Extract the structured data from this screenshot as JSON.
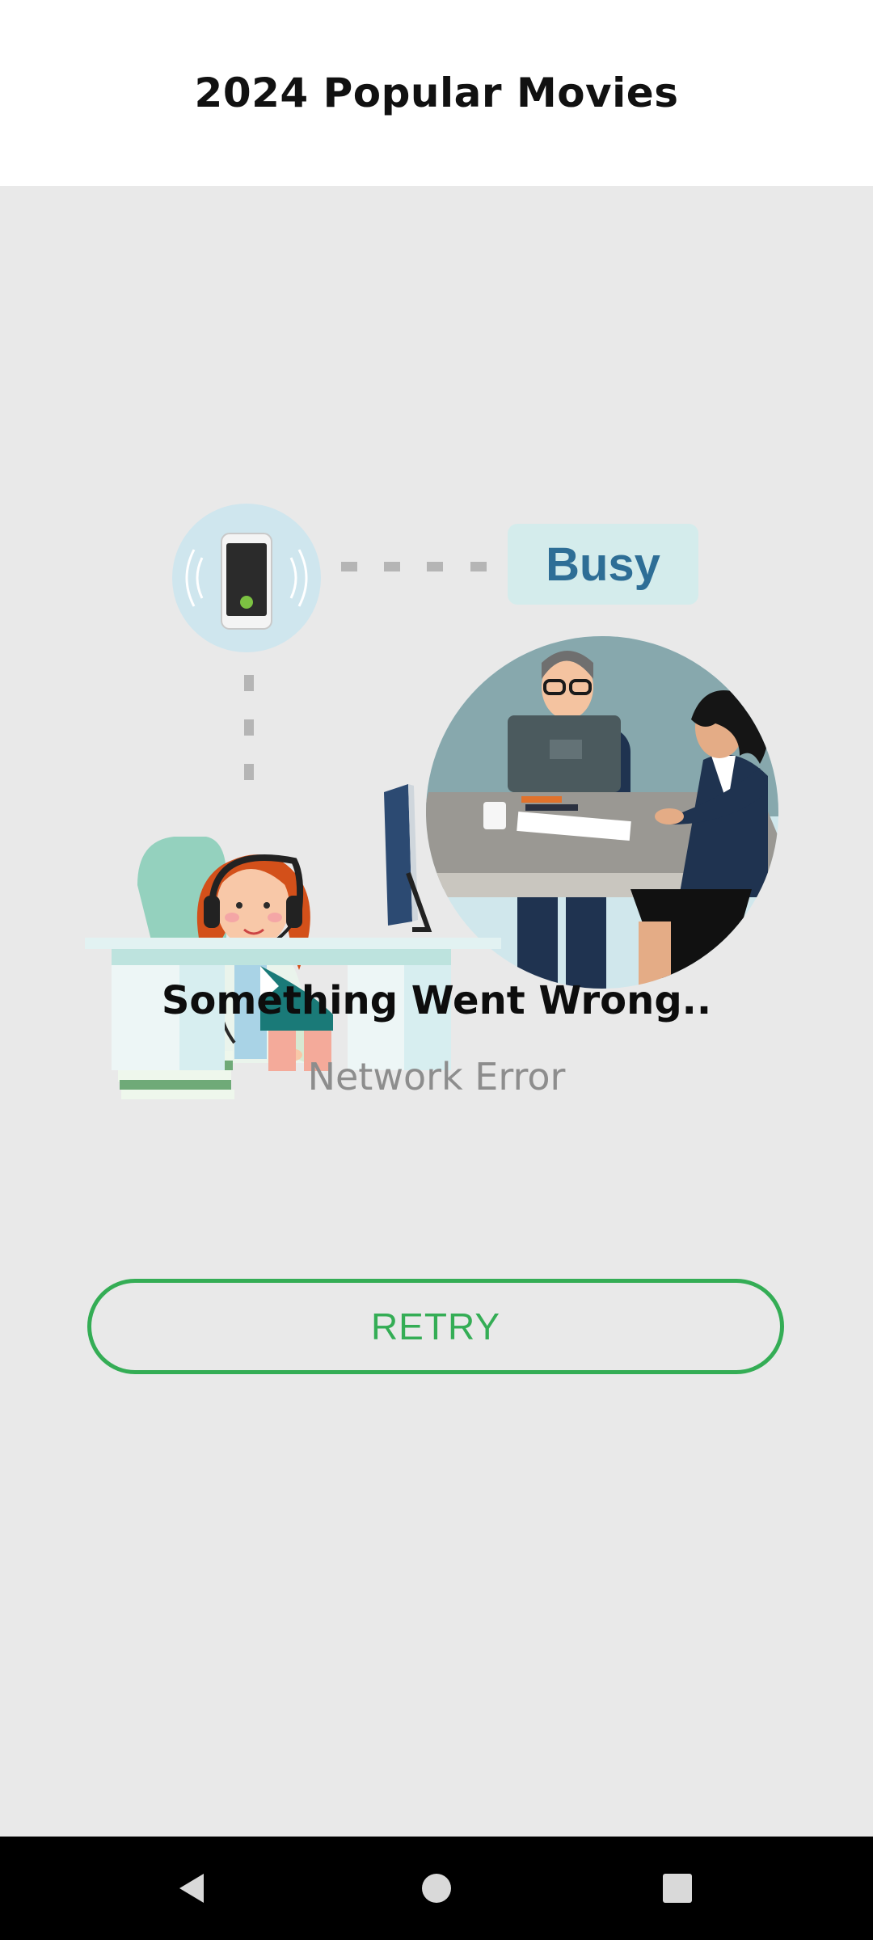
{
  "app_bar": {
    "title": "2024 Popular Movies"
  },
  "illustration": {
    "status_label": "Busy"
  },
  "error": {
    "title": "Something Went Wrong..",
    "subtitle": "Network Error"
  },
  "retry_button": {
    "label": "RETRY"
  },
  "nav_bar": {
    "back_icon": "back-triangle-icon",
    "home_icon": "home-circle-icon",
    "recents_icon": "recents-square-icon"
  },
  "colors": {
    "accent": "#34ad55",
    "background": "#e9e9e9",
    "app_bar": "#ffffff",
    "busy_text": "#2e6e96",
    "busy_badge": "#d4ecec"
  }
}
